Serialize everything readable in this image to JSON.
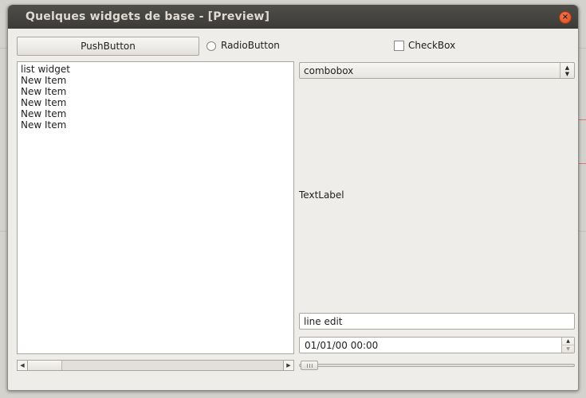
{
  "window": {
    "title": "Quelques widgets de base - [Preview]",
    "close_symbol": "×"
  },
  "pushbutton": {
    "label": "PushButton"
  },
  "radiobutton": {
    "label": "RadioButton",
    "checked": false
  },
  "checkbox": {
    "label": "CheckBox",
    "checked": false
  },
  "listwidget": {
    "items": [
      "list widget",
      "New Item",
      "New Item",
      "New Item",
      "New Item",
      "New Item"
    ]
  },
  "combobox": {
    "value": "combobox"
  },
  "textlabel": {
    "text": "TextLabel"
  },
  "lineedit": {
    "value": "line edit"
  },
  "datetimeedit": {
    "value": "01/01/00 00:00"
  },
  "slider": {
    "value": 0
  },
  "icons": {
    "close": "close-icon",
    "combo": "updown-chevron-icon",
    "scroll_left": "arrow-left-icon",
    "scroll_right": "arrow-right-icon",
    "spin_up": "arrow-up-icon",
    "spin_down": "arrow-down-icon"
  },
  "colors": {
    "titlebar": "#3c3b37",
    "window_bg": "#efedea",
    "close_button": "#e05522"
  }
}
